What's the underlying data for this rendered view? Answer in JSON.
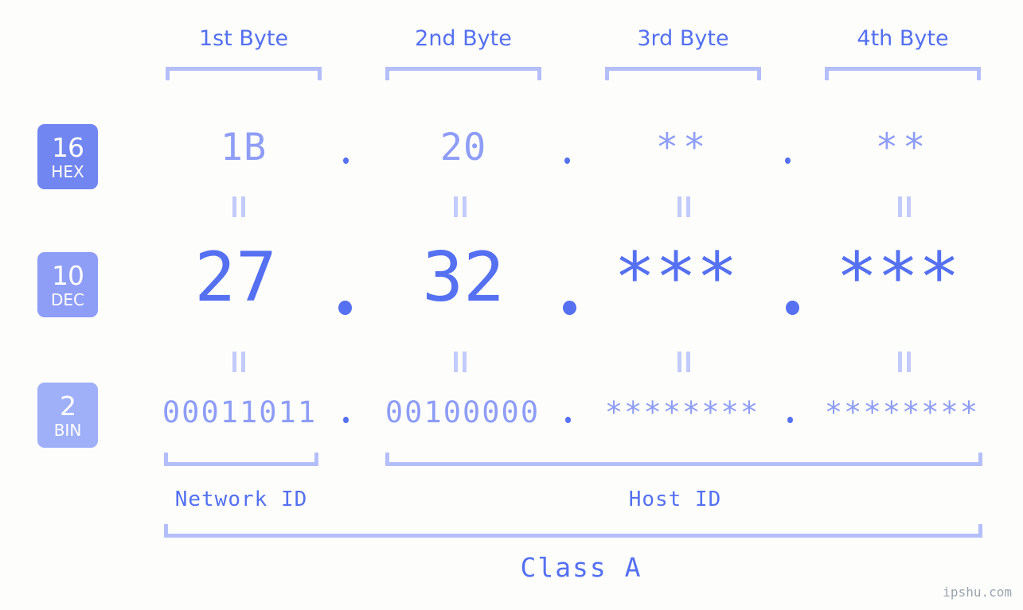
{
  "background_color": "#fdfefb",
  "colors": {
    "accent_strong": "#5570f1",
    "accent_mid": "#8e9df6",
    "accent_light": "#b4bffa",
    "equals_mark": "#c2cbfb",
    "badge_hex": "#7186f0",
    "badge_dec": "#8e9df6",
    "badge_bin": "#9fb0f8",
    "watermark": "#9aa3b0"
  },
  "byte_headers": [
    {
      "label": "1st Byte"
    },
    {
      "label": "2nd Byte"
    },
    {
      "label": "3rd Byte"
    },
    {
      "label": "4th Byte"
    }
  ],
  "bases": [
    {
      "number": "16",
      "name": "HEX"
    },
    {
      "number": "10",
      "name": "DEC"
    },
    {
      "number": "2",
      "name": "BIN"
    }
  ],
  "rows": {
    "hex": {
      "base_number": "16",
      "base_name": "HEX",
      "values": [
        "1B",
        "20",
        "**",
        "**"
      ],
      "separators": [
        ".",
        ".",
        "."
      ]
    },
    "dec": {
      "base_number": "10",
      "base_name": "DEC",
      "values": [
        "27",
        "32",
        "***",
        "***"
      ],
      "separators": [
        ".",
        ".",
        "."
      ]
    },
    "bin": {
      "base_number": "2",
      "base_name": "BIN",
      "values": [
        "00011011",
        "00100000",
        "********",
        "********"
      ],
      "separators": [
        ".",
        ".",
        "."
      ]
    }
  },
  "equals_marks": {
    "glyph": "=",
    "count_per_row": 4,
    "rows": 2
  },
  "sections": {
    "network_id": "Network ID",
    "host_id": "Host ID",
    "class": "Class A"
  },
  "watermark": "ipshu.com"
}
